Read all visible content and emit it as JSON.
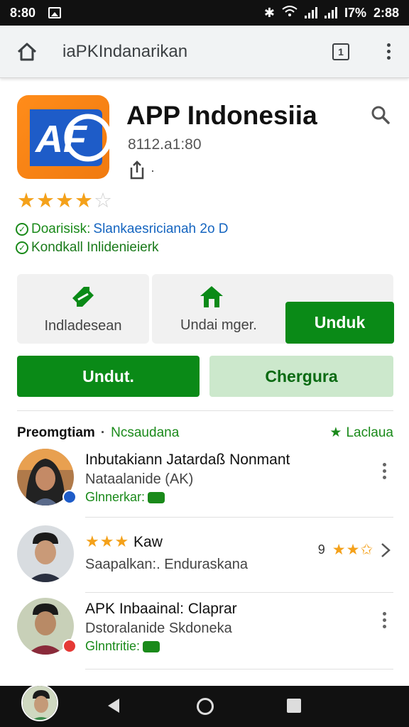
{
  "status_bar": {
    "time": "8:80",
    "battery": "I7%",
    "clock": "2:88"
  },
  "browser": {
    "url": "iaPKIndanarikan",
    "tab_count": "1"
  },
  "app": {
    "title": "APP Indonesiia",
    "subtitle": "8112.a1:80",
    "icon_text": "AF",
    "stars": "★★★★",
    "stars_empty": "☆",
    "check_1_label": "Doarisisk:",
    "check_1_value": "Slankaesricianah 2o D",
    "check_2_label": "Kondkall Inlidenieierk"
  },
  "actions": {
    "card_1_label": "Indladesean",
    "card_2_label": "Undai mger.",
    "unduh_label": "Unduk",
    "unduh2_label": "Undut.",
    "pale_label": "Chergura"
  },
  "section": {
    "title": "Preomgtiam",
    "subtitle": "Ncsaudana",
    "right_label": "Laclaua"
  },
  "reviews": [
    {
      "name": "Inbutakiann Jatardaß Nonmant",
      "sub": "Nataalanide (AK)",
      "tag": "Glnnerkar:"
    },
    {
      "stars": "★★★",
      "name": "Kaw",
      "sub": "Saapalkan:. Enduraskana",
      "rating_num": "9",
      "rating_stars": "★★✩"
    },
    {
      "name": "APK Inbaainal: Claprar",
      "sub": "Dstoralanide Skdoneka",
      "tag": "Glnntritie:"
    }
  ],
  "colors": {
    "accent_green": "#0a8a17",
    "star": "#f4a11a",
    "icon_orange": "#ff8c1a",
    "icon_blue": "#1e5cc8"
  }
}
